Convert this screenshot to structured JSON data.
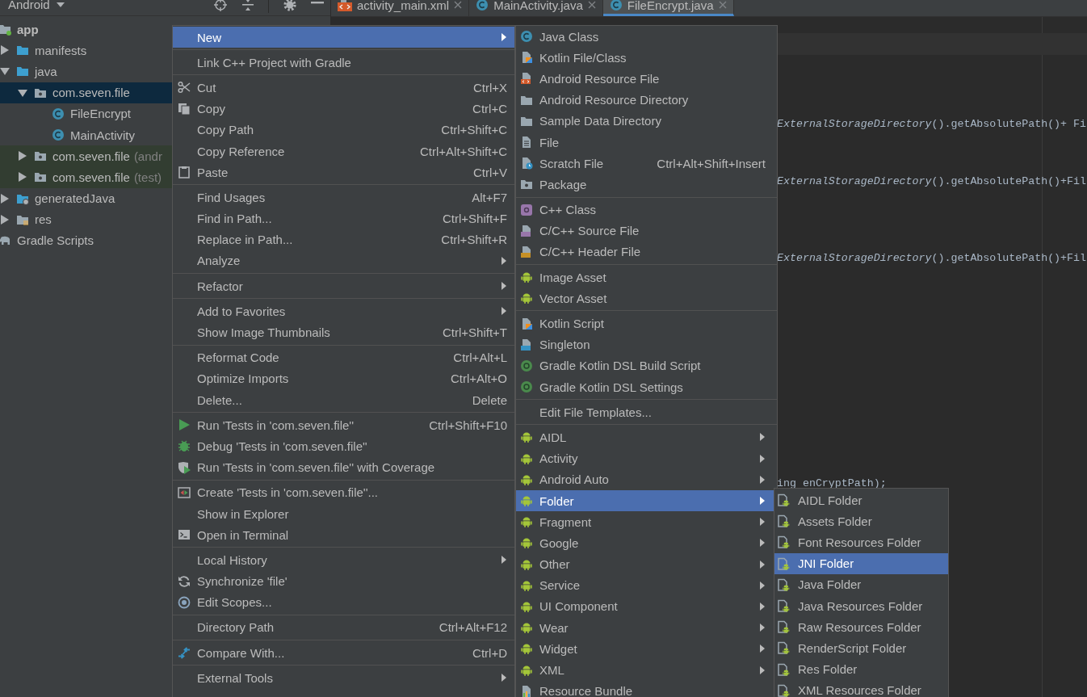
{
  "project_panel": {
    "view": "Android",
    "tree": [
      {
        "name": "app",
        "kind": "module",
        "selected": false,
        "children": [
          {
            "name": "manifests",
            "kind": "folder",
            "expanded": false,
            "selected": false
          },
          {
            "name": "java",
            "kind": "folder",
            "expanded": true,
            "selected": false,
            "children": [
              {
                "name": "com.seven.file",
                "kind": "package",
                "expanded": true,
                "selected": true,
                "children": [
                  {
                    "name": "FileEncrypt",
                    "kind": "class",
                    "selected": false
                  },
                  {
                    "name": "MainActivity",
                    "kind": "class",
                    "selected": false
                  }
                ]
              },
              {
                "name": "com.seven.file",
                "suffix": "(andr",
                "kind": "test-package",
                "expanded": false,
                "selected": false
              },
              {
                "name": "com.seven.file",
                "suffix": "(test)",
                "kind": "test-package",
                "expanded": false,
                "selected": false
              }
            ]
          },
          {
            "name": "generatedJava",
            "kind": "generated-folder",
            "expanded": false,
            "selected": false
          },
          {
            "name": "res",
            "kind": "res-folder",
            "expanded": false,
            "selected": false
          }
        ]
      },
      {
        "name": "Gradle Scripts",
        "kind": "gradle-scripts",
        "selected": false
      }
    ]
  },
  "editor": {
    "tabs": [
      {
        "label": "activity_main.xml",
        "kind": "xml",
        "selected": false
      },
      {
        "label": "MainActivity.java",
        "kind": "class",
        "selected": false
      },
      {
        "label": "FileEncrypt.java",
        "kind": "class",
        "selected": true
      }
    ],
    "code_lines": [
      {
        "text": "*ExternalStorageDirectory*().getAbsolutePath()+ Fi"
      },
      {
        "text": "*ExternalStorageDirectory*().getAbsolutePath()+Fil"
      },
      {
        "text": "*ExternalStorageDirectory*().getAbsolutePath()+Fil"
      },
      {
        "text": "ing enCryptPath);"
      }
    ]
  },
  "context_menu": {
    "groups": [
      {
        "items": [
          {
            "label": "New",
            "kind": "plain",
            "submenu": true,
            "selected": true
          }
        ]
      },
      {
        "items": [
          {
            "label": "Link C++ Project with Gradle",
            "kind": "plain",
            "submenu": false,
            "selected": false
          }
        ]
      },
      {
        "items": [
          {
            "label": "Cut",
            "kind": "cut",
            "shortcut": "Ctrl+X",
            "submenu": false,
            "selected": false
          },
          {
            "label": "Copy",
            "kind": "copy",
            "shortcut": "Ctrl+C",
            "submenu": false,
            "selected": false
          },
          {
            "label": "Copy Path",
            "kind": "plain",
            "shortcut": "Ctrl+Shift+C",
            "submenu": false,
            "selected": false
          },
          {
            "label": "Copy Reference",
            "kind": "plain",
            "shortcut": "Ctrl+Alt+Shift+C",
            "submenu": false,
            "selected": false
          },
          {
            "label": "Paste",
            "kind": "paste",
            "shortcut": "Ctrl+V",
            "submenu": false,
            "selected": false
          }
        ]
      },
      {
        "items": [
          {
            "label": "Find Usages",
            "kind": "plain",
            "shortcut": "Alt+F7",
            "submenu": false,
            "selected": false
          },
          {
            "label": "Find in Path...",
            "kind": "plain",
            "shortcut": "Ctrl+Shift+F",
            "submenu": false,
            "selected": false
          },
          {
            "label": "Replace in Path...",
            "kind": "plain",
            "shortcut": "Ctrl+Shift+R",
            "submenu": false,
            "selected": false
          },
          {
            "label": "Analyze",
            "kind": "plain",
            "submenu": true,
            "selected": false
          }
        ]
      },
      {
        "items": [
          {
            "label": "Refactor",
            "kind": "plain",
            "submenu": true,
            "selected": false
          }
        ]
      },
      {
        "items": [
          {
            "label": "Add to Favorites",
            "kind": "plain",
            "submenu": true,
            "selected": false
          },
          {
            "label": "Show Image Thumbnails",
            "kind": "plain",
            "shortcut": "Ctrl+Shift+T",
            "submenu": false,
            "selected": false
          }
        ]
      },
      {
        "items": [
          {
            "label": "Reformat Code",
            "kind": "plain",
            "shortcut": "Ctrl+Alt+L",
            "submenu": false,
            "selected": false
          },
          {
            "label": "Optimize Imports",
            "kind": "plain",
            "shortcut": "Ctrl+Alt+O",
            "submenu": false,
            "selected": false
          },
          {
            "label": "Delete...",
            "kind": "plain",
            "shortcut": "Delete",
            "submenu": false,
            "selected": false
          }
        ]
      },
      {
        "items": [
          {
            "label": "Run 'Tests in 'com.seven.file''",
            "kind": "run",
            "shortcut": "Ctrl+Shift+F10",
            "submenu": false,
            "selected": false
          },
          {
            "label": "Debug 'Tests in 'com.seven.file''",
            "kind": "debug",
            "submenu": false,
            "selected": false
          },
          {
            "label": "Run 'Tests in 'com.seven.file'' with Coverage",
            "kind": "coverage",
            "submenu": false,
            "selected": false
          }
        ]
      },
      {
        "items": [
          {
            "label": "Create 'Tests in 'com.seven.file''...",
            "kind": "create-test",
            "submenu": false,
            "selected": false
          },
          {
            "label": "Show in Explorer",
            "kind": "plain",
            "submenu": false,
            "selected": false
          },
          {
            "label": "Open in Terminal",
            "kind": "terminal",
            "submenu": false,
            "selected": false
          }
        ]
      },
      {
        "items": [
          {
            "label": "Local History",
            "kind": "plain",
            "submenu": true,
            "selected": false
          },
          {
            "label": "Synchronize 'file'",
            "kind": "sync",
            "submenu": false,
            "selected": false
          },
          {
            "label": "Edit Scopes...",
            "kind": "scopes",
            "submenu": false,
            "selected": false
          }
        ]
      },
      {
        "items": [
          {
            "label": "Directory Path",
            "kind": "plain",
            "shortcut": "Ctrl+Alt+F12",
            "submenu": false,
            "selected": false
          }
        ]
      },
      {
        "items": [
          {
            "label": "Compare With...",
            "kind": "compare",
            "shortcut": "Ctrl+D",
            "submenu": false,
            "selected": false
          }
        ]
      },
      {
        "items": [
          {
            "label": "External Tools",
            "kind": "plain",
            "submenu": true,
            "selected": false
          }
        ]
      }
    ]
  },
  "new_submenu": {
    "groups": [
      {
        "items": [
          {
            "label": "Java Class",
            "kind": "class",
            "submenu": false,
            "selected": false
          },
          {
            "label": "Kotlin File/Class",
            "kind": "kotlin",
            "submenu": false,
            "selected": false
          },
          {
            "label": "Android Resource File",
            "kind": "res-file",
            "submenu": false,
            "selected": false
          },
          {
            "label": "Android Resource Directory",
            "kind": "folder",
            "submenu": false,
            "selected": false
          },
          {
            "label": "Sample Data Directory",
            "kind": "folder",
            "submenu": false,
            "selected": false
          },
          {
            "label": "File",
            "kind": "file",
            "submenu": false,
            "selected": false
          },
          {
            "label": "Scratch File",
            "kind": "scratch",
            "shortcut": "Ctrl+Alt+Shift+Insert",
            "submenu": false,
            "selected": false
          },
          {
            "label": "Package",
            "kind": "package",
            "submenu": false,
            "selected": false
          }
        ]
      },
      {
        "items": [
          {
            "label": "C++ Class",
            "kind": "cpp-class",
            "submenu": false,
            "selected": false
          },
          {
            "label": "C/C++ Source File",
            "kind": "c-source",
            "submenu": false,
            "selected": false
          },
          {
            "label": "C/C++ Header File",
            "kind": "c-header",
            "submenu": false,
            "selected": false
          }
        ]
      },
      {
        "items": [
          {
            "label": "Image Asset",
            "kind": "android",
            "submenu": false,
            "selected": false
          },
          {
            "label": "Vector Asset",
            "kind": "android",
            "submenu": false,
            "selected": false
          }
        ]
      },
      {
        "items": [
          {
            "label": "Kotlin Script",
            "kind": "kotlin-script",
            "submenu": false,
            "selected": false
          },
          {
            "label": "Singleton",
            "kind": "singleton",
            "submenu": false,
            "selected": false
          },
          {
            "label": "Gradle Kotlin DSL Build Script",
            "kind": "gradle",
            "submenu": false,
            "selected": false
          },
          {
            "label": "Gradle Kotlin DSL Settings",
            "kind": "gradle",
            "submenu": false,
            "selected": false
          }
        ]
      },
      {
        "items": [
          {
            "label": "Edit File Templates...",
            "kind": "plain",
            "submenu": false,
            "selected": false
          }
        ]
      },
      {
        "items": [
          {
            "label": "AIDL",
            "kind": "android",
            "submenu": true,
            "selected": false
          },
          {
            "label": "Activity",
            "kind": "android",
            "submenu": true,
            "selected": false
          },
          {
            "label": "Android Auto",
            "kind": "android",
            "submenu": true,
            "selected": false
          },
          {
            "label": "Folder",
            "kind": "android",
            "submenu": true,
            "selected": true
          },
          {
            "label": "Fragment",
            "kind": "android",
            "submenu": true,
            "selected": false
          },
          {
            "label": "Google",
            "kind": "android",
            "submenu": true,
            "selected": false
          },
          {
            "label": "Other",
            "kind": "android",
            "submenu": true,
            "selected": false
          },
          {
            "label": "Service",
            "kind": "android",
            "submenu": true,
            "selected": false
          },
          {
            "label": "UI Component",
            "kind": "android",
            "submenu": true,
            "selected": false
          },
          {
            "label": "Wear",
            "kind": "android",
            "submenu": true,
            "selected": false
          },
          {
            "label": "Widget",
            "kind": "android",
            "submenu": true,
            "selected": false
          },
          {
            "label": "XML",
            "kind": "android",
            "submenu": true,
            "selected": false
          },
          {
            "label": "Resource Bundle",
            "kind": "bundle",
            "submenu": false,
            "selected": false
          }
        ]
      }
    ]
  },
  "folder_submenu": {
    "groups": [
      {
        "items": [
          {
            "label": "AIDL Folder",
            "kind": "android-folder",
            "submenu": false,
            "selected": false
          },
          {
            "label": "Assets Folder",
            "kind": "android-folder",
            "submenu": false,
            "selected": false
          },
          {
            "label": "Font Resources Folder",
            "kind": "android-folder",
            "submenu": false,
            "selected": false
          },
          {
            "label": "JNI Folder",
            "kind": "android-folder",
            "submenu": false,
            "selected": true
          },
          {
            "label": "Java Folder",
            "kind": "android-folder",
            "submenu": false,
            "selected": false
          },
          {
            "label": "Java Resources Folder",
            "kind": "android-folder",
            "submenu": false,
            "selected": false
          },
          {
            "label": "Raw Resources Folder",
            "kind": "android-folder",
            "submenu": false,
            "selected": false
          },
          {
            "label": "RenderScript Folder",
            "kind": "android-folder",
            "submenu": false,
            "selected": false
          },
          {
            "label": "Res Folder",
            "kind": "android-folder",
            "submenu": false,
            "selected": false
          },
          {
            "label": "XML Resources Folder",
            "kind": "android-folder",
            "submenu": false,
            "selected": false
          }
        ]
      }
    ]
  }
}
